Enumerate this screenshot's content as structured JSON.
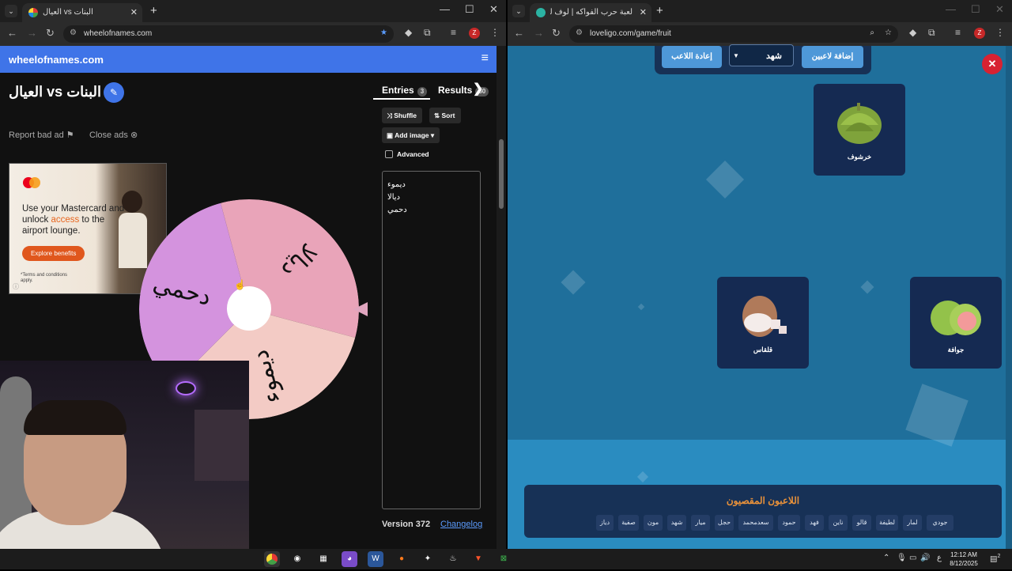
{
  "left_browser": {
    "tab_title": "العيال vs البنات",
    "url": "wheelofnames.com"
  },
  "right_browser": {
    "tab_title": "لعبة حرب الفواكه | لوف ليجو يوم...",
    "url": "loveligo.com/game/fruit"
  },
  "wheel_page": {
    "brand": "wheelofnames.com",
    "title": "البنات vs العيال",
    "report_ad": "Report bad ad",
    "close_ads": "Close ads",
    "ad": {
      "headline_1": "Use your Mastercard and unlock ",
      "headline_hl": "access",
      "headline_2": " to the airport lounge.",
      "cta": "Explore benefits",
      "fine_print": "*Terms and conditions apply."
    },
    "wheel_segments": [
      {
        "name": "ديالا",
        "color": "#e9a4b9"
      },
      {
        "name": "ديموء",
        "color": "#f3cbc5"
      },
      {
        "name": "دحمي",
        "color": "#d493de"
      }
    ],
    "entries_tab": "Entries",
    "entries_count": "3",
    "results_tab": "Results",
    "results_count": "50",
    "shuffle": "Shuffle",
    "sort": "Sort",
    "add_image": "Add image",
    "advanced": "Advanced",
    "entries": [
      "ديموء",
      "ديالا",
      "دحمي"
    ],
    "version": "Version 372",
    "changelog": "Changelog"
  },
  "fruit_page": {
    "add_players": "إضافة لاعبين",
    "selected_player": "شهد",
    "return_player": "إعادة اللاعب",
    "cards": [
      {
        "name": "خرشوف"
      },
      {
        "name": "قلقاس"
      },
      {
        "name": "جوافة"
      }
    ],
    "eliminated_title": "اللاعبون المقصيون",
    "eliminated": [
      "جودي",
      "لمار",
      "لطيفة",
      "قالو",
      "ناين",
      "فهد",
      "حمود",
      "سعدمحمد",
      "حجل",
      "ميار",
      "شهد",
      "مون",
      "صفية",
      "دياز"
    ]
  },
  "taskbar": {
    "time": "12:12 AM",
    "date": "8/12/2025",
    "lang": "ع",
    "notifications": "2"
  }
}
